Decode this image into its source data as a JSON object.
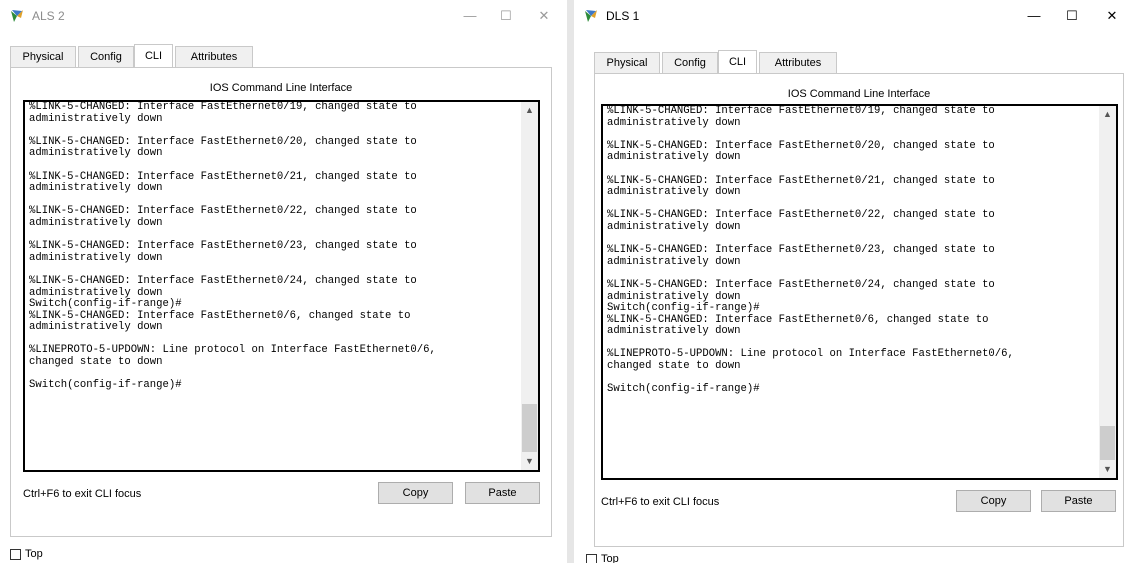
{
  "windows": [
    {
      "title": "ALS 2",
      "controls": {
        "minimize": "—",
        "maximize": "☐",
        "close": "✕"
      },
      "tabs": [
        "Physical",
        "Config",
        "CLI",
        "Attributes"
      ],
      "active_tab": "CLI",
      "cli_header": "IOS Command Line Interface",
      "terminal_text": "%LINK-5-CHANGED: Interface FastEthernet0/19, changed state to\nadministratively down\n\n%LINK-5-CHANGED: Interface FastEthernet0/20, changed state to\nadministratively down\n\n%LINK-5-CHANGED: Interface FastEthernet0/21, changed state to\nadministratively down\n\n%LINK-5-CHANGED: Interface FastEthernet0/22, changed state to\nadministratively down\n\n%LINK-5-CHANGED: Interface FastEthernet0/23, changed state to\nadministratively down\n\n%LINK-5-CHANGED: Interface FastEthernet0/24, changed state to\nadministratively down\nSwitch(config-if-range)#\n%LINK-5-CHANGED: Interface FastEthernet0/6, changed state to\nadministratively down\n\n%LINEPROTO-5-UPDOWN: Line protocol on Interface FastEthernet0/6,\nchanged state to down\n\nSwitch(config-if-range)#",
      "hint": "Ctrl+F6 to exit CLI focus",
      "copy_label": "Copy",
      "paste_label": "Paste",
      "top_label": "Top",
      "top_checked": false
    },
    {
      "title": "DLS 1",
      "controls": {
        "minimize": "—",
        "maximize": "☐",
        "close": "✕"
      },
      "tabs": [
        "Physical",
        "Config",
        "CLI",
        "Attributes"
      ],
      "active_tab": "CLI",
      "cli_header": "IOS Command Line Interface",
      "terminal_text": "%LINK-5-CHANGED: Interface FastEthernet0/19, changed state to\nadministratively down\n\n%LINK-5-CHANGED: Interface FastEthernet0/20, changed state to\nadministratively down\n\n%LINK-5-CHANGED: Interface FastEthernet0/21, changed state to\nadministratively down\n\n%LINK-5-CHANGED: Interface FastEthernet0/22, changed state to\nadministratively down\n\n%LINK-5-CHANGED: Interface FastEthernet0/23, changed state to\nadministratively down\n\n%LINK-5-CHANGED: Interface FastEthernet0/24, changed state to\nadministratively down\nSwitch(config-if-range)#\n%LINK-5-CHANGED: Interface FastEthernet0/6, changed state to\nadministratively down\n\n%LINEPROTO-5-UPDOWN: Line protocol on Interface FastEthernet0/6,\nchanged state to down\n\nSwitch(config-if-range)#",
      "hint": "Ctrl+F6 to exit CLI focus",
      "copy_label": "Copy",
      "paste_label": "Paste",
      "top_label": "Top",
      "top_checked": false
    }
  ]
}
